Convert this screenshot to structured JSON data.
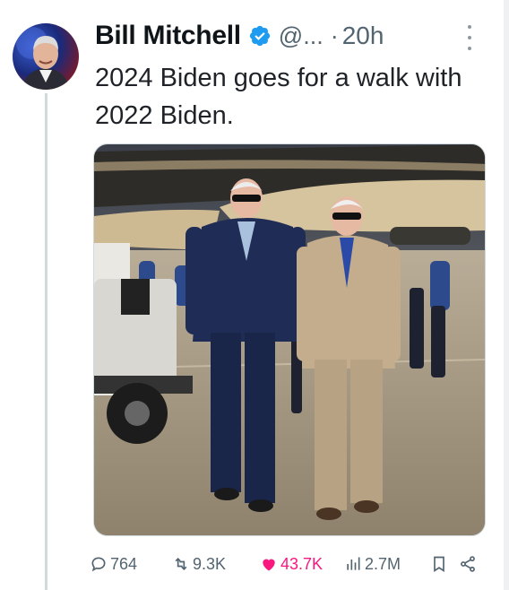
{
  "tweet": {
    "author": {
      "display_name": "Bill Mitchell",
      "handle": "@...",
      "verified": true,
      "avatar_icon": "profile-photo"
    },
    "separator": "·",
    "timestamp": "20h",
    "text": "2024 Biden goes for a walk with 2022 Biden.",
    "media_icon": "photo"
  },
  "actions": {
    "replies": "764",
    "retweets": "9.3K",
    "likes": "43.7K",
    "views": "2.7M"
  },
  "colors": {
    "verified_blue": "#1d9bf0",
    "like_pink": "#f91880",
    "muted_gray": "#536471"
  }
}
